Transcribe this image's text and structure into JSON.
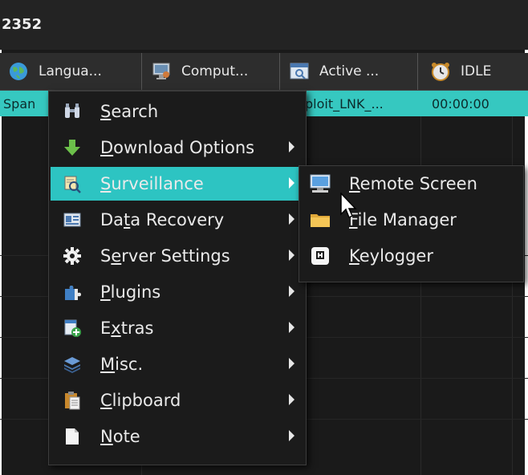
{
  "window": {
    "title": "2352"
  },
  "columns": [
    {
      "label": "Langua...",
      "icon": "globe-icon"
    },
    {
      "label": "Comput...",
      "icon": "computer-icon"
    },
    {
      "label": "Active ...",
      "icon": "window-icon"
    },
    {
      "label": "IDLE",
      "icon": "alarm-clock-icon"
    }
  ],
  "selected_row": {
    "language": "Span",
    "active": "ploit_LNK_...",
    "idle": "00:00:00"
  },
  "context_menu": {
    "items": [
      {
        "pre": "",
        "u": "S",
        "post": "earch",
        "icon": "binoculars-icon",
        "has_submenu": false
      },
      {
        "pre": "",
        "u": "D",
        "post": "ownload Options",
        "icon": "download-arrow-icon",
        "has_submenu": true
      },
      {
        "pre": "",
        "u": "S",
        "post": "urveillance",
        "icon": "surveillance-icon",
        "has_submenu": true,
        "highlighted": true
      },
      {
        "pre": "Da",
        "u": "t",
        "post": "a Recovery",
        "icon": "data-card-icon",
        "has_submenu": true
      },
      {
        "pre": "S",
        "u": "e",
        "post": "rver Settings",
        "icon": "gear-icon",
        "has_submenu": true
      },
      {
        "pre": "",
        "u": "P",
        "post": "lugins",
        "icon": "puzzle-icon",
        "has_submenu": true
      },
      {
        "pre": "E",
        "u": "x",
        "post": "tras",
        "icon": "folder-plus-icon",
        "has_submenu": true
      },
      {
        "pre": "",
        "u": "M",
        "post": "isc.",
        "icon": "layers-icon",
        "has_submenu": true
      },
      {
        "pre": "",
        "u": "C",
        "post": "lipboard",
        "icon": "clipboard-icon",
        "has_submenu": true
      },
      {
        "pre": "",
        "u": "N",
        "post": "ote",
        "icon": "note-icon",
        "has_submenu": true
      }
    ]
  },
  "submenu": {
    "items": [
      {
        "pre": "",
        "u": "R",
        "post": "emote Screen",
        "icon": "monitor-icon"
      },
      {
        "pre": "",
        "u": "F",
        "post": "ile Manager",
        "icon": "folder-icon"
      },
      {
        "pre": "",
        "u": "K",
        "post": "eylogger",
        "icon": "keyboard-key-icon"
      }
    ]
  }
}
